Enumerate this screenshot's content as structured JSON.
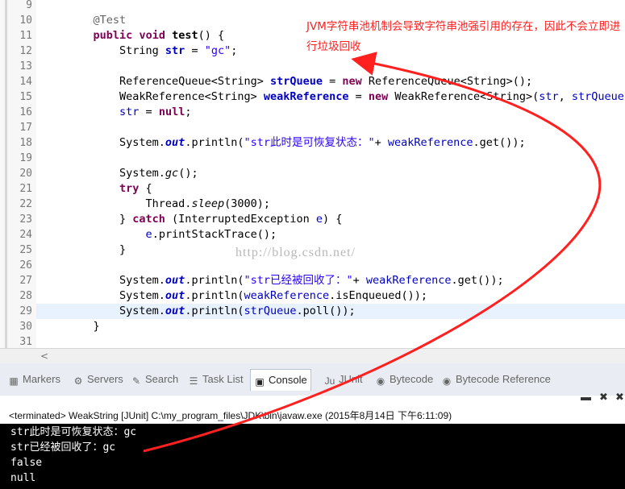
{
  "editor": {
    "lines": [
      {
        "n": "9",
        "tokens": []
      },
      {
        "n": "10",
        "tokens": [
          {
            "t": "    "
          },
          {
            "t": "@Test",
            "c": "ann"
          }
        ]
      },
      {
        "n": "11",
        "tokens": [
          {
            "t": "    "
          },
          {
            "t": "public",
            "c": "kw"
          },
          {
            "t": " "
          },
          {
            "t": "void",
            "c": "kw"
          },
          {
            "t": " "
          },
          {
            "t": "test",
            "c": "bold"
          },
          {
            "t": "() {"
          }
        ]
      },
      {
        "n": "12",
        "tokens": [
          {
            "t": "        String "
          },
          {
            "t": "str",
            "c": "bfld"
          },
          {
            "t": " = "
          },
          {
            "t": "\"gc\"",
            "c": "str"
          },
          {
            "t": ";"
          }
        ]
      },
      {
        "n": "13",
        "tokens": []
      },
      {
        "n": "14",
        "tokens": [
          {
            "t": "        ReferenceQueue<String> "
          },
          {
            "t": "strQueue",
            "c": "bfld"
          },
          {
            "t": " = "
          },
          {
            "t": "new",
            "c": "kw"
          },
          {
            "t": " ReferenceQueue<String>();"
          }
        ]
      },
      {
        "n": "15",
        "tokens": [
          {
            "t": "        WeakReference<String> "
          },
          {
            "t": "weakReference",
            "c": "bfld"
          },
          {
            "t": " = "
          },
          {
            "t": "new",
            "c": "kw"
          },
          {
            "t": " WeakReference<String>("
          },
          {
            "t": "str",
            "c": "fld"
          },
          {
            "t": ", "
          },
          {
            "t": "strQueue",
            "c": "fld"
          },
          {
            "t": ");"
          }
        ]
      },
      {
        "n": "16",
        "tokens": [
          {
            "t": "        "
          },
          {
            "t": "str",
            "c": "fld"
          },
          {
            "t": " = "
          },
          {
            "t": "null",
            "c": "kw"
          },
          {
            "t": ";"
          }
        ]
      },
      {
        "n": "17",
        "tokens": []
      },
      {
        "n": "18",
        "tokens": [
          {
            "t": "        System."
          },
          {
            "t": "out",
            "c": "sfld"
          },
          {
            "t": ".println("
          },
          {
            "t": "\"str此时是可恢复状态：\"",
            "c": "str"
          },
          {
            "t": "+ "
          },
          {
            "t": "weakReference",
            "c": "fld"
          },
          {
            "t": ".get());"
          }
        ]
      },
      {
        "n": "19",
        "tokens": []
      },
      {
        "n": "20",
        "tokens": [
          {
            "t": "        System."
          },
          {
            "t": "gc",
            "c": "ital"
          },
          {
            "t": "();"
          }
        ]
      },
      {
        "n": "21",
        "tokens": [
          {
            "t": "        "
          },
          {
            "t": "try",
            "c": "kw"
          },
          {
            "t": " {"
          }
        ]
      },
      {
        "n": "22",
        "tokens": [
          {
            "t": "            Thread."
          },
          {
            "t": "sleep",
            "c": "ital"
          },
          {
            "t": "(3000);"
          }
        ]
      },
      {
        "n": "23",
        "tokens": [
          {
            "t": "        } "
          },
          {
            "t": "catch",
            "c": "kw"
          },
          {
            "t": " (InterruptedException "
          },
          {
            "t": "e",
            "c": "fld"
          },
          {
            "t": ") {"
          }
        ]
      },
      {
        "n": "24",
        "tokens": [
          {
            "t": "            "
          },
          {
            "t": "e",
            "c": "fld"
          },
          {
            "t": ".printStackTrace();"
          }
        ]
      },
      {
        "n": "25",
        "tokens": [
          {
            "t": "        }"
          }
        ]
      },
      {
        "n": "26",
        "tokens": []
      },
      {
        "n": "27",
        "tokens": [
          {
            "t": "        System."
          },
          {
            "t": "out",
            "c": "sfld"
          },
          {
            "t": ".println("
          },
          {
            "t": "\"str已经被回收了：\"",
            "c": "str"
          },
          {
            "t": "+ "
          },
          {
            "t": "weakReference",
            "c": "fld"
          },
          {
            "t": ".get());"
          }
        ]
      },
      {
        "n": "28",
        "tokens": [
          {
            "t": "        System."
          },
          {
            "t": "out",
            "c": "sfld"
          },
          {
            "t": ".println("
          },
          {
            "t": "weakReference",
            "c": "fld"
          },
          {
            "t": ".isEnqueued());"
          }
        ]
      },
      {
        "n": "29",
        "tokens": [
          {
            "t": "        System."
          },
          {
            "t": "out",
            "c": "sfld"
          },
          {
            "t": ".println("
          },
          {
            "t": "strQueue",
            "c": "fld"
          },
          {
            "t": ".poll());"
          }
        ]
      },
      {
        "n": "30",
        "tokens": [
          {
            "t": "    }"
          }
        ]
      },
      {
        "n": "31",
        "tokens": []
      }
    ],
    "current_line": "29"
  },
  "annotation": {
    "text": "JVM字符串池机制会导致字符串池强引用的存在，因此不会立即进行垃圾回收",
    "color": "#ff1f1f"
  },
  "watermark": "http://blog.csdn.net/",
  "views": {
    "tabs": [
      {
        "label": "Markers",
        "icon": "markers-icon",
        "glyph": "▦"
      },
      {
        "label": "Servers",
        "icon": "servers-icon",
        "glyph": "⚙"
      },
      {
        "label": "Search",
        "icon": "search-icon",
        "glyph": "✎"
      },
      {
        "label": "Task List",
        "icon": "task-list-icon",
        "glyph": "☰"
      },
      {
        "label": "Console",
        "icon": "console-icon",
        "glyph": "▣",
        "active": true
      },
      {
        "label": "JUnit",
        "icon": "junit-icon",
        "glyph": "Ju"
      },
      {
        "label": "Bytecode",
        "icon": "bytecode-icon",
        "glyph": "◉"
      },
      {
        "label": "Bytecode Reference",
        "icon": "bytecode-reference-icon",
        "glyph": "◉"
      }
    ]
  },
  "console": {
    "header": "<terminated> WeakString [JUnit] C:\\my_program_files\\JDK\\bin\\javaw.exe (2015年8月14日 下午6:11:09)",
    "lines": [
      "str此时是可恢复状态：gc",
      "str已经被回收了：gc",
      "false",
      "null"
    ]
  }
}
